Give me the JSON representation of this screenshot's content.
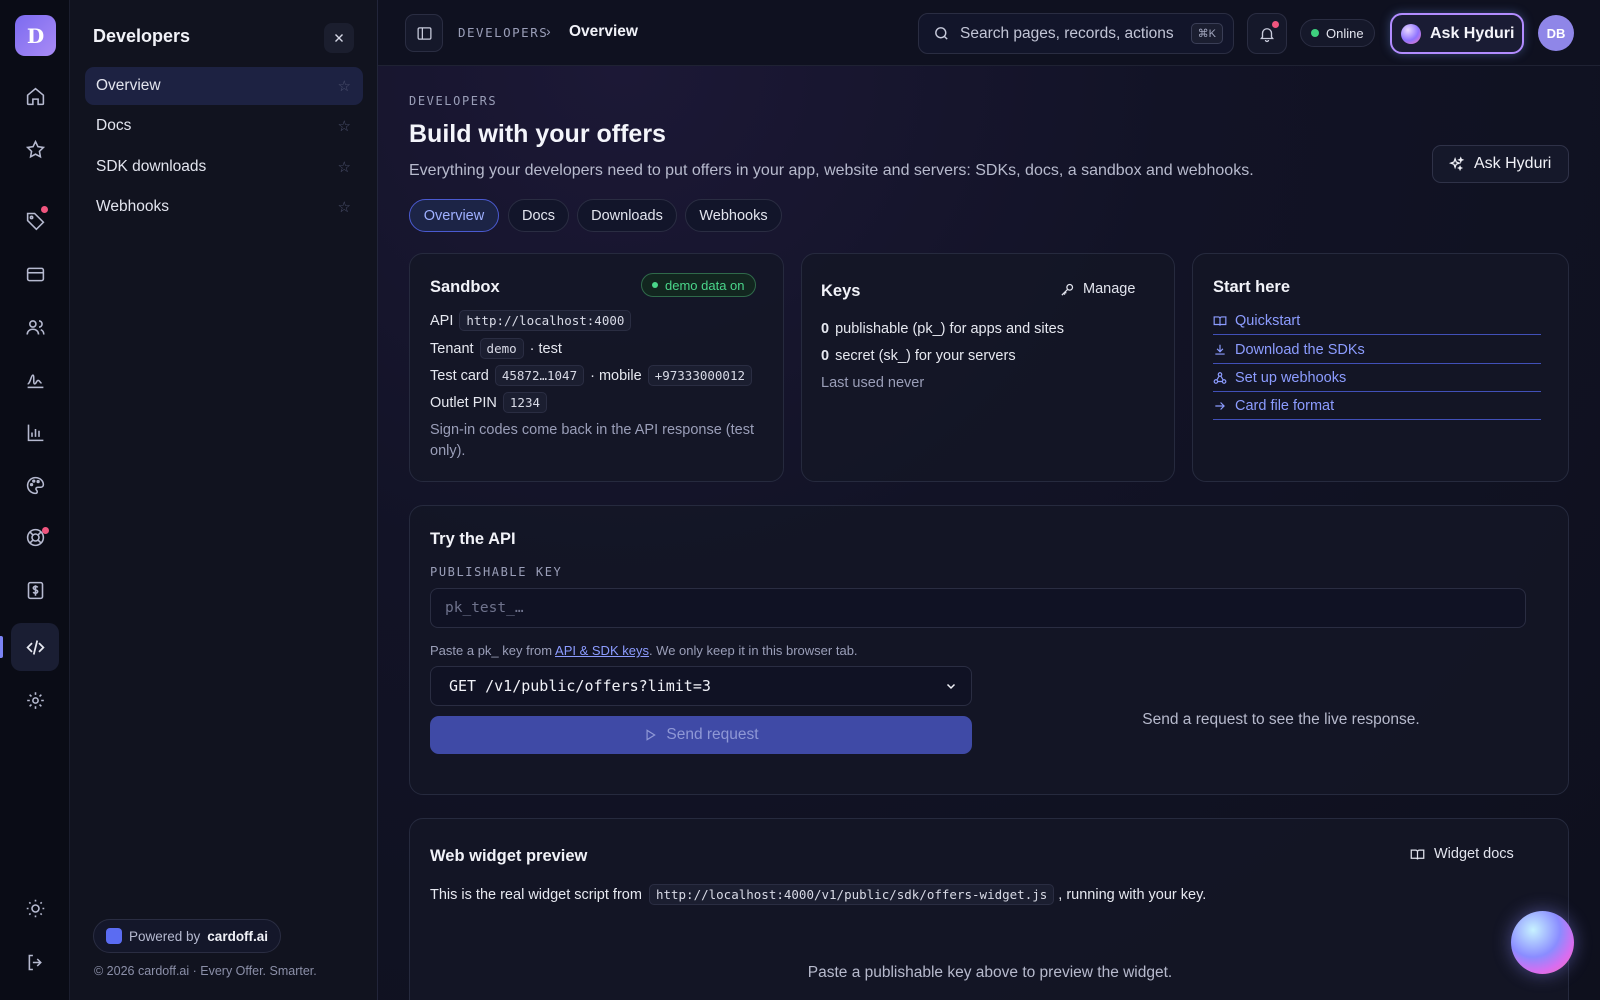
{
  "app": {
    "logo_letter": "D",
    "brand": "cardoff.ai"
  },
  "rail": {
    "items": [
      {
        "icon": "home-icon"
      },
      {
        "icon": "star-icon"
      },
      {
        "icon": "tag-icon",
        "badge": true
      },
      {
        "icon": "card-icon"
      },
      {
        "icon": "users-icon"
      },
      {
        "icon": "signature-icon"
      },
      {
        "icon": "chart-icon"
      },
      {
        "icon": "palette-icon"
      },
      {
        "icon": "lifebuoy-icon",
        "badge": true
      },
      {
        "icon": "dollar-doc-icon"
      },
      {
        "icon": "code-icon",
        "active": true
      },
      {
        "icon": "gear-icon"
      }
    ],
    "bottom": [
      {
        "icon": "sun-icon"
      },
      {
        "icon": "logout-icon"
      }
    ]
  },
  "panel": {
    "title": "Developers",
    "items": [
      {
        "label": "Overview",
        "active": true
      },
      {
        "label": "Docs"
      },
      {
        "label": "SDK downloads"
      },
      {
        "label": "Webhooks"
      }
    ],
    "powered_prefix": "Powered by",
    "powered_brand": "cardoff.ai",
    "copyright": "© 2026 cardoff.ai · Every Offer. Smarter."
  },
  "topbar": {
    "crumb_root": "DEVELOPERS",
    "crumb_sep": "›",
    "crumb_current": "Overview",
    "search_placeholder": "Search pages, records, actions",
    "search_kbd": "⌘K",
    "status": "Online",
    "ask_label": "Ask Hyduri",
    "avatar": "DB"
  },
  "page": {
    "eyebrow": "DEVELOPERS",
    "title": "Build with your offers",
    "subtitle": "Everything your developers need to put offers in your app, website and servers: SDKs, docs, a sandbox and webhooks.",
    "ask_label": "Ask Hyduri",
    "tabs": [
      {
        "label": "Overview",
        "active": true
      },
      {
        "label": "Docs"
      },
      {
        "label": "Downloads"
      },
      {
        "label": "Webhooks"
      }
    ]
  },
  "sandbox": {
    "title": "Sandbox",
    "pill": "demo data on",
    "api_label": "API",
    "api_value": "http://localhost:4000",
    "tenant_label": "Tenant",
    "tenant_value": "demo",
    "tenant_suffix": "· test",
    "card_label": "Test card",
    "card_value": "45872…1047",
    "mobile_label": "· mobile",
    "mobile_value": "+97333000012",
    "pin_label": "Outlet PIN",
    "pin_value": "1234",
    "note": "Sign-in codes come back in the API response (test only)."
  },
  "keys": {
    "title": "Keys",
    "manage": "Manage",
    "pub_count": "0",
    "pub_text": "publishable (pk_) for apps and sites",
    "sec_count": "0",
    "sec_text": "secret (sk_) for your servers",
    "last_used": "Last used never"
  },
  "start": {
    "title": "Start here",
    "links": [
      {
        "label": "Quickstart",
        "icon": "book-icon"
      },
      {
        "label": "Download the SDKs",
        "icon": "download-icon"
      },
      {
        "label": "Set up webhooks",
        "icon": "webhook-icon"
      },
      {
        "label": "Card file format",
        "icon": "arrow-right-icon"
      }
    ]
  },
  "try_api": {
    "title": "Try the API",
    "key_label": "PUBLISHABLE KEY",
    "key_placeholder": "pk_test_…",
    "help_prefix": "Paste a pk_ key from",
    "help_link": "API & SDK keys",
    "help_suffix": ". We only keep it in this browser tab.",
    "endpoint": "GET /v1/public/offers?limit=3",
    "send_label": "Send request",
    "response_hint": "Send a request to see the live response."
  },
  "widget": {
    "title": "Web widget preview",
    "docs_label": "Widget docs",
    "desc_prefix": "This is the real widget script from",
    "script_url": "http://localhost:4000/v1/public/sdk/offers-widget.js",
    "desc_suffix": ", running with your key.",
    "empty": "Paste a publishable key above to preview the widget."
  }
}
